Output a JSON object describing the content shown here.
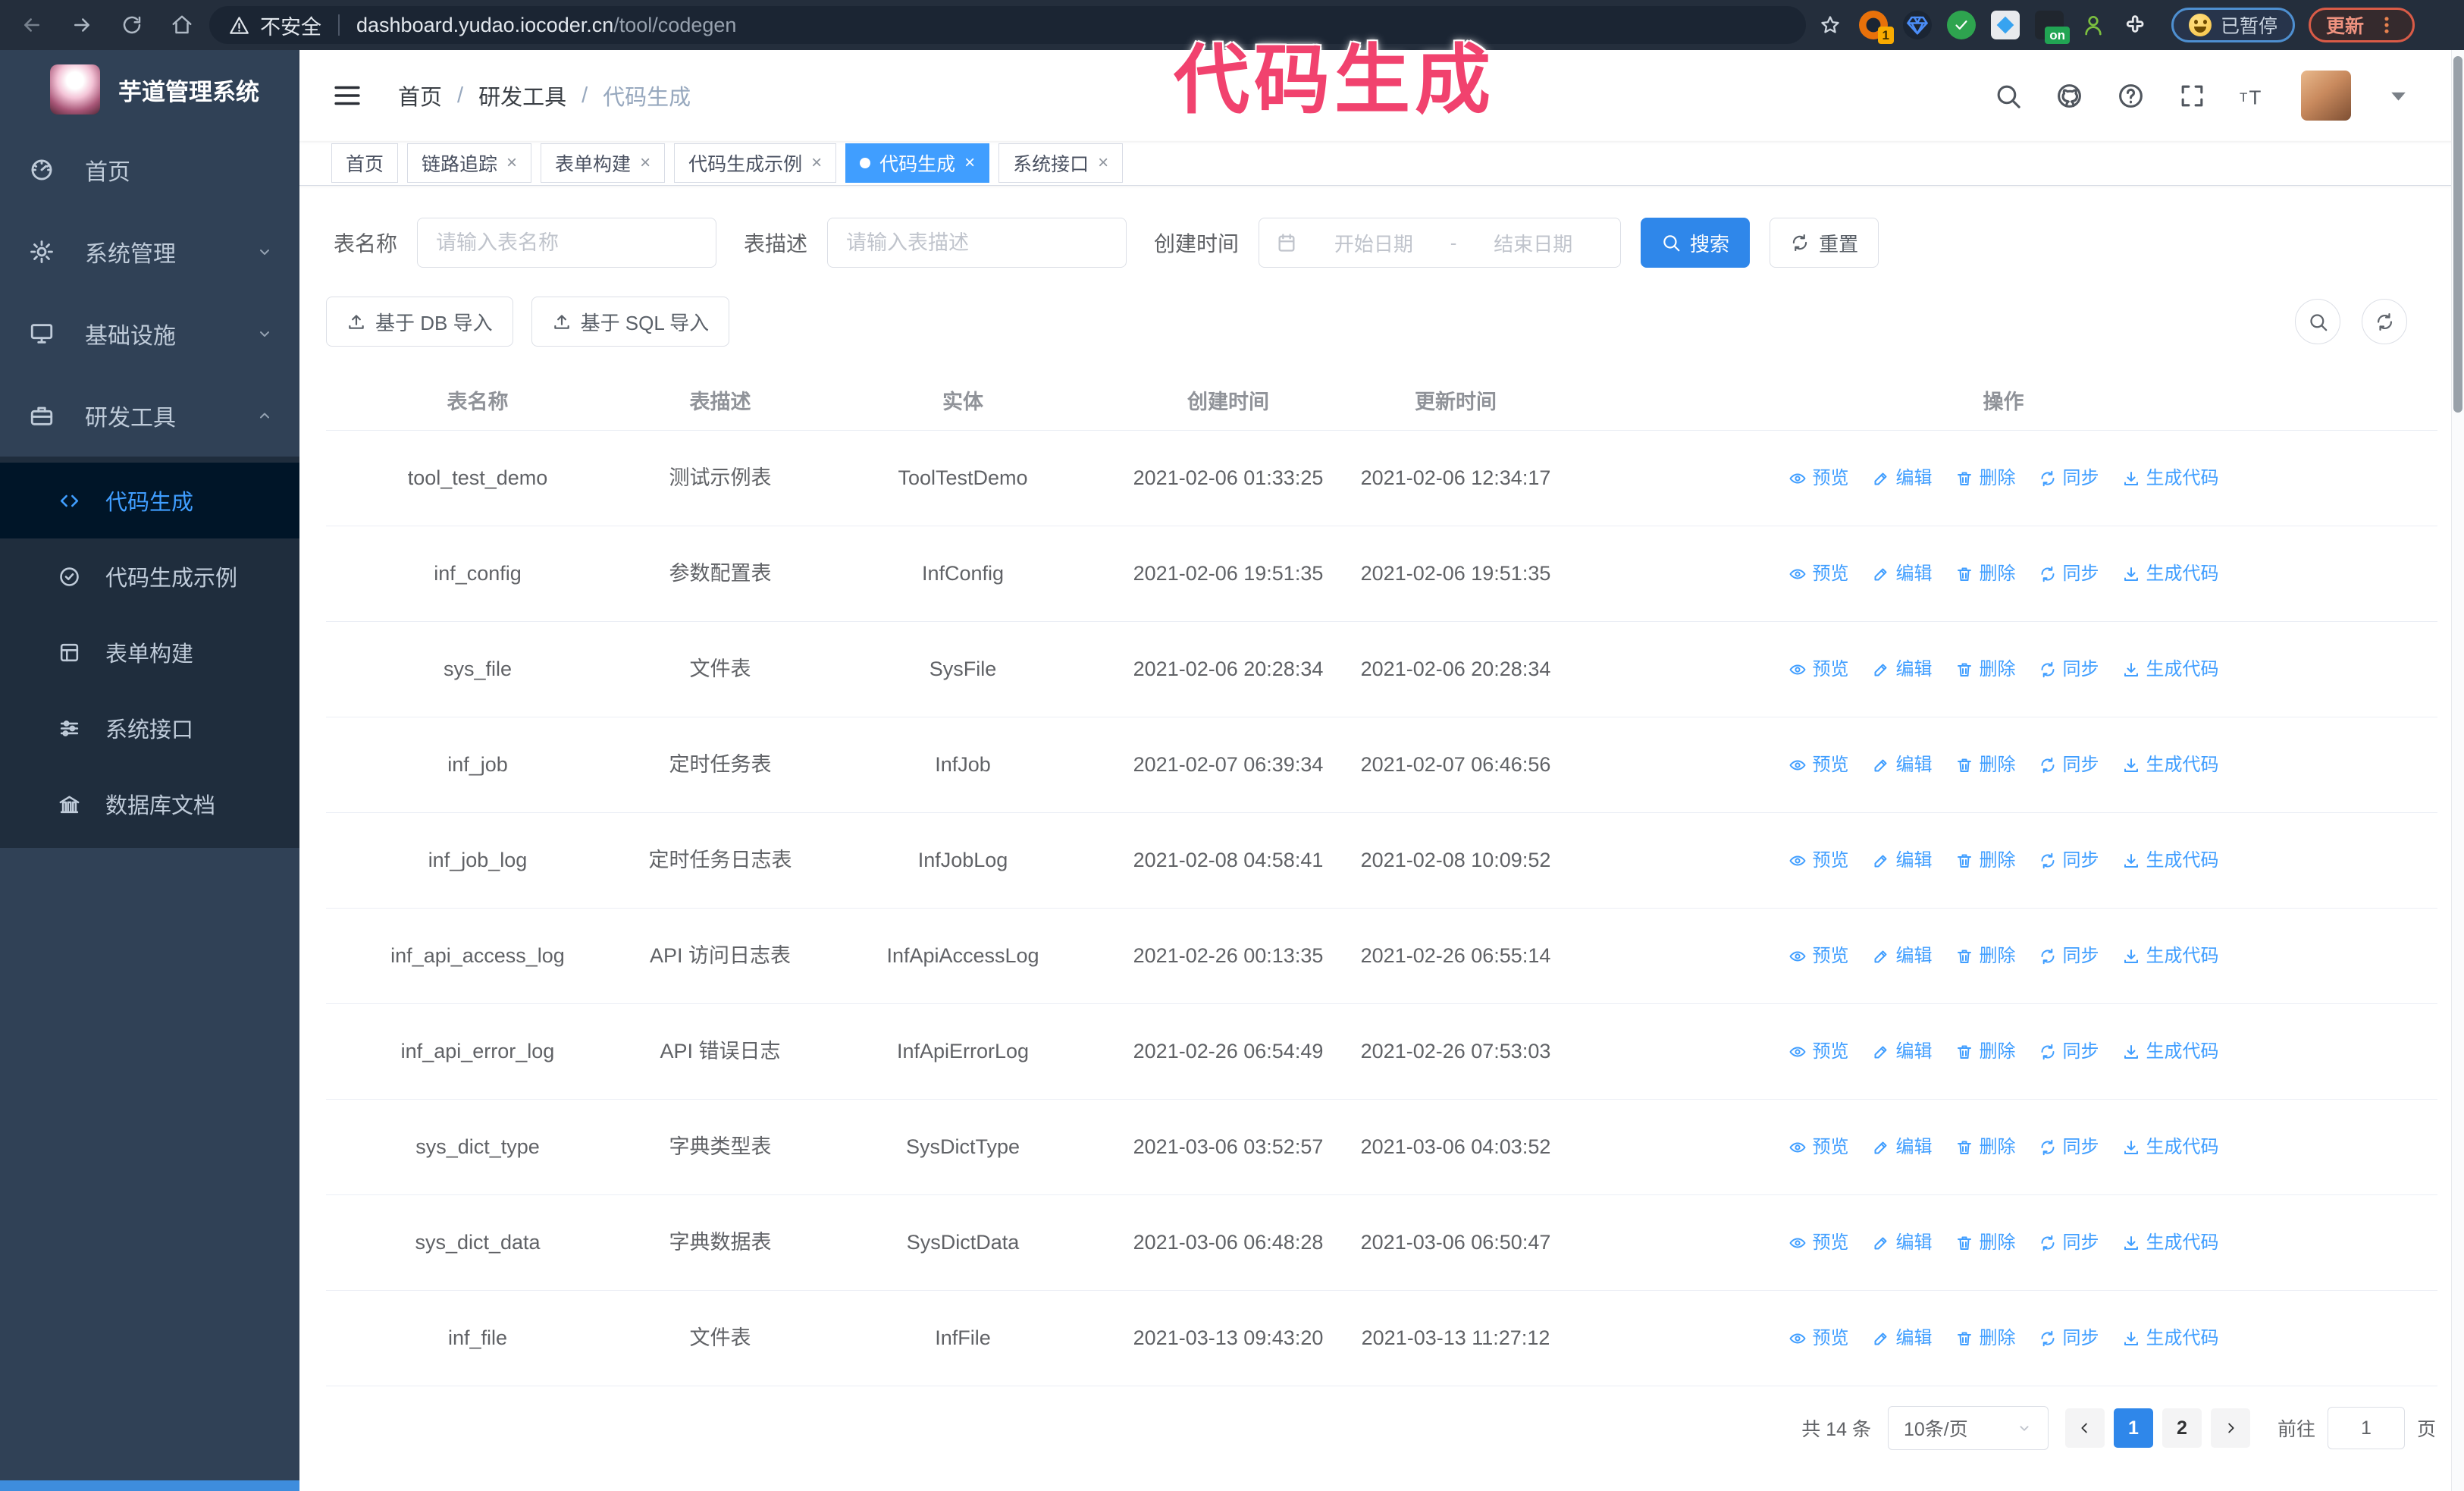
{
  "browser": {
    "security_warning": "不安全",
    "url_host": "dashboard.yudao.iocoder.cn",
    "url_path": "/tool/codegen",
    "extension_badge": "1",
    "extension_on_badge": "on",
    "paused_badge": "已暂停",
    "update_button": "更新"
  },
  "annotation": {
    "text": "代码生成"
  },
  "sidebar": {
    "logo_title": "芋道管理系统",
    "items": [
      {
        "id": "home",
        "icon": "dashboard",
        "label": "首页"
      },
      {
        "id": "system",
        "icon": "gear",
        "label": "系统管理",
        "chevron": "down"
      },
      {
        "id": "infra",
        "icon": "monitor",
        "label": "基础设施",
        "chevron": "down"
      },
      {
        "id": "devtools",
        "icon": "briefcase",
        "label": "研发工具",
        "chevron": "up",
        "open": true
      }
    ],
    "submenu": [
      {
        "id": "codegen",
        "icon": "code",
        "label": "代码生成",
        "active": true
      },
      {
        "id": "codegen-example",
        "icon": "badge-check",
        "label": "代码生成示例"
      },
      {
        "id": "form-builder",
        "icon": "form",
        "label": "表单构建"
      },
      {
        "id": "system-api",
        "icon": "sliders",
        "label": "系统接口"
      },
      {
        "id": "db-doc",
        "icon": "db",
        "label": "数据库文档"
      }
    ]
  },
  "breadcrumb": {
    "items": [
      "首页",
      "研发工具",
      "代码生成"
    ]
  },
  "tabs": [
    {
      "id": "home",
      "label": "首页",
      "closable": false
    },
    {
      "id": "trace",
      "label": "链路追踪",
      "closable": true
    },
    {
      "id": "form-builder",
      "label": "表单构建",
      "closable": true
    },
    {
      "id": "codegen-example",
      "label": "代码生成示例",
      "closable": true
    },
    {
      "id": "codegen",
      "label": "代码生成",
      "closable": true,
      "active": true
    },
    {
      "id": "system-api",
      "label": "系统接口",
      "closable": true
    }
  ],
  "filters": {
    "table_name_label": "表名称",
    "table_name_placeholder": "请输入表名称",
    "table_desc_label": "表描述",
    "table_desc_placeholder": "请输入表描述",
    "create_time_label": "创建时间",
    "date_start_placeholder": "开始日期",
    "date_separator": "-",
    "date_end_placeholder": "结束日期",
    "search_label": "搜索",
    "reset_label": "重置"
  },
  "toolbar": {
    "import_db_label": "基于 DB 导入",
    "import_sql_label": "基于 SQL 导入"
  },
  "table": {
    "columns": [
      "表名称",
      "表描述",
      "实体",
      "创建时间",
      "更新时间",
      "操作"
    ],
    "actions": [
      {
        "id": "preview",
        "icon": "eye",
        "label": "预览"
      },
      {
        "id": "edit",
        "icon": "edit",
        "label": "编辑"
      },
      {
        "id": "delete",
        "icon": "trash",
        "label": "删除"
      },
      {
        "id": "sync",
        "icon": "sync",
        "label": "同步"
      },
      {
        "id": "generate",
        "icon": "download",
        "label": "生成代码"
      }
    ],
    "rows": [
      {
        "name": "tool_test_demo",
        "desc": "测试示例表",
        "entity": "ToolTestDemo",
        "created": "2021-02-06 01:33:25",
        "updated": "2021-02-06 12:34:17"
      },
      {
        "name": "inf_config",
        "desc": "参数配置表",
        "entity": "InfConfig",
        "created": "2021-02-06 19:51:35",
        "updated": "2021-02-06 19:51:35"
      },
      {
        "name": "sys_file",
        "desc": "文件表",
        "entity": "SysFile",
        "created": "2021-02-06 20:28:34",
        "updated": "2021-02-06 20:28:34"
      },
      {
        "name": "inf_job",
        "desc": "定时任务表",
        "entity": "InfJob",
        "created": "2021-02-07 06:39:34",
        "updated": "2021-02-07 06:46:56"
      },
      {
        "name": "inf_job_log",
        "desc": "定时任务日志表",
        "entity": "InfJobLog",
        "created": "2021-02-08 04:58:41",
        "updated": "2021-02-08 10:09:52"
      },
      {
        "name": "inf_api_access_log",
        "desc": "API 访问日志表",
        "entity": "InfApiAccessLog",
        "created": "2021-02-26 00:13:35",
        "updated": "2021-02-26 06:55:14"
      },
      {
        "name": "inf_api_error_log",
        "desc": "API 错误日志",
        "entity": "InfApiErrorLog",
        "created": "2021-02-26 06:54:49",
        "updated": "2021-02-26 07:53:03"
      },
      {
        "name": "sys_dict_type",
        "desc": "字典类型表",
        "entity": "SysDictType",
        "created": "2021-03-06 03:52:57",
        "updated": "2021-03-06 04:03:52"
      },
      {
        "name": "sys_dict_data",
        "desc": "字典数据表",
        "entity": "SysDictData",
        "created": "2021-03-06 06:48:28",
        "updated": "2021-03-06 06:50:47"
      },
      {
        "name": "inf_file",
        "desc": "文件表",
        "entity": "InfFile",
        "created": "2021-03-13 09:43:20",
        "updated": "2021-03-13 11:27:12"
      }
    ]
  },
  "pagination": {
    "total_text": "共 14 条",
    "page_size": "10条/页",
    "pages": [
      "1",
      "2"
    ],
    "active_page": "1",
    "goto_label": "前往",
    "goto_value": "1",
    "goto_suffix": "页"
  },
  "colors": {
    "accent": "#409eff",
    "button_blue": "#2f87ea",
    "annotation_pink": "#f1426e",
    "sidebar_bg": "#304156",
    "submenu_bg": "#1f2d3d",
    "submenu_active_bg": "#001528",
    "chrome_bg": "#242e3c"
  }
}
